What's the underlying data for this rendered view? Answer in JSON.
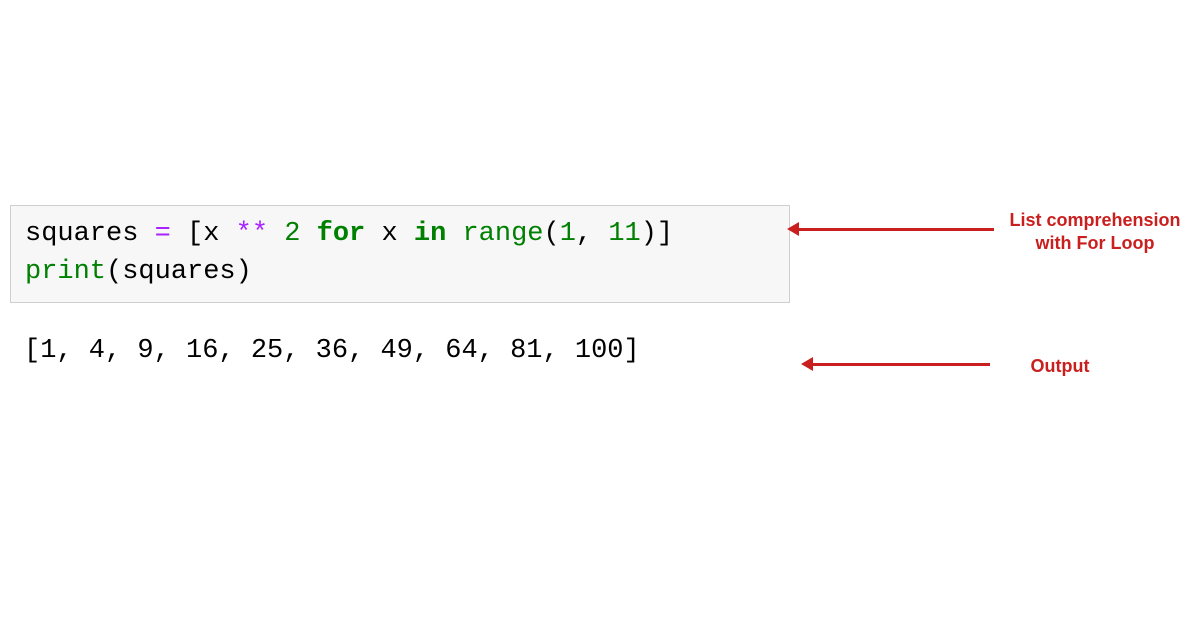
{
  "code": {
    "line1": {
      "p1": "squares ",
      "eq": "=",
      "sp1": " ",
      "lb": "[",
      "var": "x ",
      "star": "**",
      "sp2": " ",
      "num2": "2",
      "sp3": " ",
      "for": "for",
      "sp4": " x ",
      "in": "in",
      "sp5": " ",
      "range": "range",
      "args": "(",
      "n1": "1",
      "comma": ", ",
      "n11": "11",
      "close": ")]"
    },
    "line2": {
      "print": "print",
      "args": "(squares)"
    }
  },
  "output": "[1, 4, 9, 16, 25, 36, 49, 64, 81, 100]",
  "annotations": {
    "label1": "List comprehension\nwith For Loop",
    "label2": "Output"
  }
}
